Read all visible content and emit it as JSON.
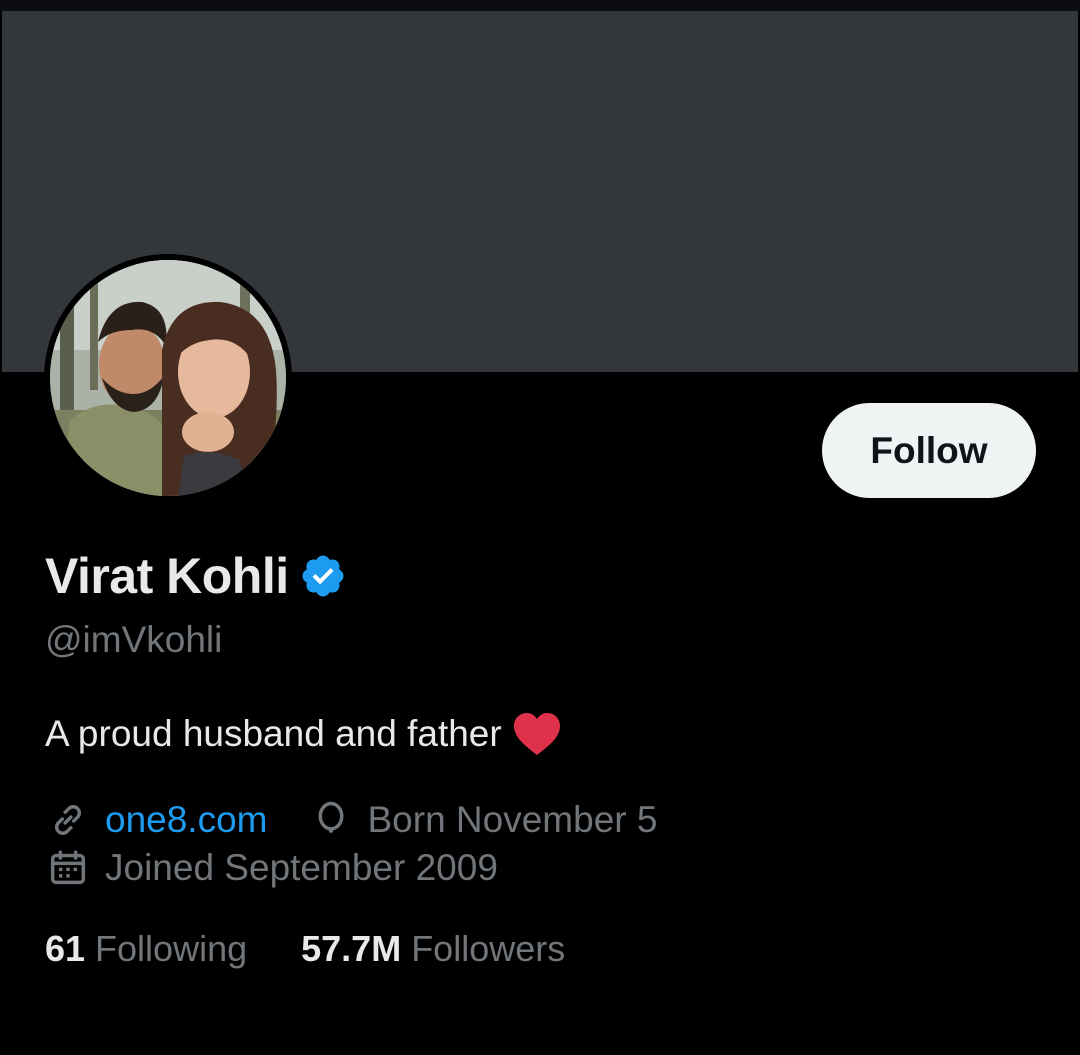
{
  "profile": {
    "display_name": "Virat Kohli",
    "verified": true,
    "verified_icon": "verified-badge-icon",
    "handle": "@imVkohli",
    "bio": "A proud husband and father",
    "bio_emoji": "heart-icon",
    "follow_label": "Follow",
    "website": "one8.com",
    "birthday": "Born November 5",
    "joined": "Joined September 2009",
    "following_count": "61",
    "following_label": "Following",
    "followers_count": "57.7M",
    "followers_label": "Followers",
    "avatar_icon": "profile-photo"
  },
  "colors": {
    "background": "#000000",
    "banner": "#33363a",
    "primary_text": "#e7e9ea",
    "secondary_text": "#71767b",
    "link": "#1d9bf0",
    "verified": "#1d9bf0",
    "heart": "#e0314b",
    "follow_button_bg": "#eff3f4",
    "follow_button_text": "#0f1419"
  }
}
